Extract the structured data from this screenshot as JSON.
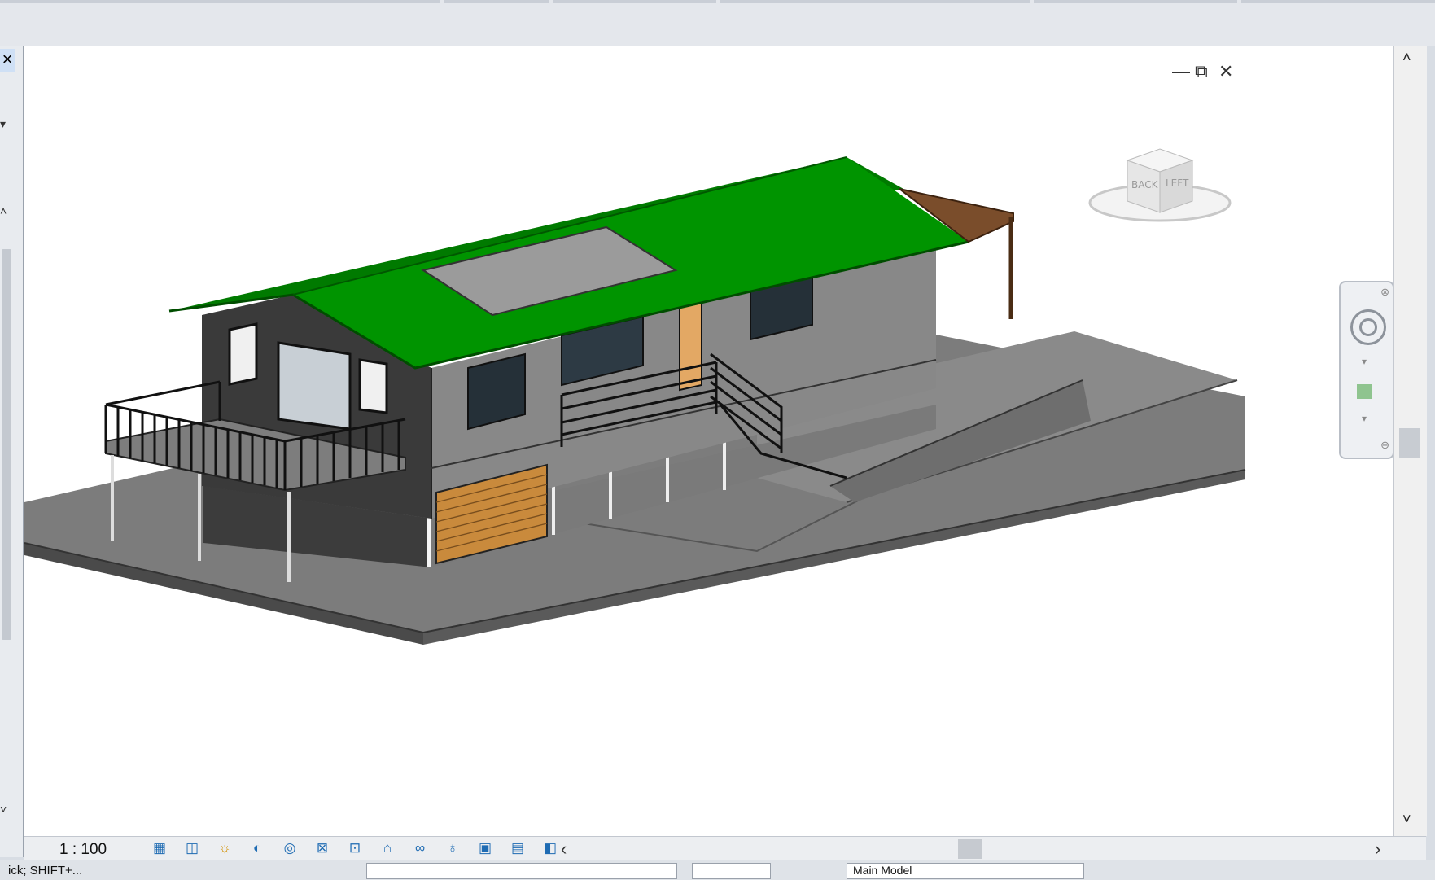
{
  "viewport": {
    "scale": "1 : 100",
    "window_controls": [
      "minimize-icon",
      "restore-icon",
      "close-icon"
    ],
    "viewcube": {
      "faces": [
        "BACK",
        "LEFT"
      ]
    },
    "model": {
      "roof_color": "#008f00",
      "wall_color": "#858585",
      "ground_color": "#7c7c7c",
      "garage_door_color": "#c98a3c",
      "door_color": "#e3a864",
      "canopy_color": "#7a4d2b"
    }
  },
  "status": {
    "left_tip": "ick; SHIFT+...",
    "model_label": "Main Model"
  },
  "view_control_icons": [
    "detail-level-icon",
    "visual-style-icon",
    "sun-path-icon",
    "shadows-icon",
    "render-icon",
    "crop-view-icon",
    "show-crop-region-icon",
    "unlock-3d-view-icon",
    "temporary-hide-icon",
    "reveal-hidden-icon",
    "temporary-view-properties-icon",
    "highlight-displacement-icon",
    "hide-analytical-model-icon"
  ]
}
